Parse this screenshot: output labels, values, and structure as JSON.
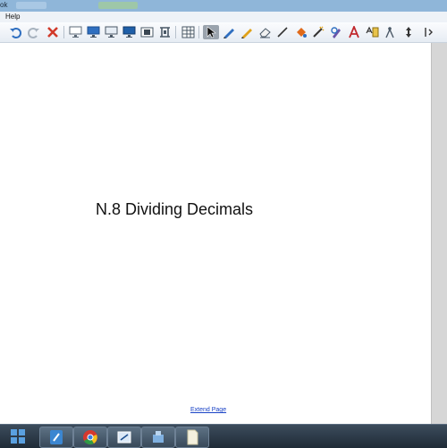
{
  "window": {
    "title": "ok"
  },
  "menu": {
    "help": "Help"
  },
  "toolbar": {
    "tools": [
      "undo-icon",
      "redo-icon",
      "delete-icon",
      "screen-shade-icon",
      "display-icon",
      "show-hide-screen-icon",
      "monitor-icon",
      "capture-icon",
      "document-camera-icon",
      "table-icon",
      "select-icon",
      "pen-icon",
      "creative-pen-icon",
      "eraser-icon",
      "line-icon",
      "fill-icon",
      "magic-pen-icon",
      "shape-recognition-icon",
      "text-icon",
      "properties-icon",
      "compass-icon",
      "move-toolbar-icon"
    ]
  },
  "page": {
    "title": "N.8 Dividing Decimals",
    "extend_link": "Extend Page"
  },
  "taskbar": {
    "apps": [
      "start-icon",
      "notebook-app-icon",
      "chrome-app-icon",
      "board-app-icon",
      "tools-app-icon",
      "document-app-icon"
    ]
  },
  "colors": {
    "accent": "#1a43c6",
    "titlebar": "#8fb6d9",
    "taskbar": "#2b3947"
  }
}
